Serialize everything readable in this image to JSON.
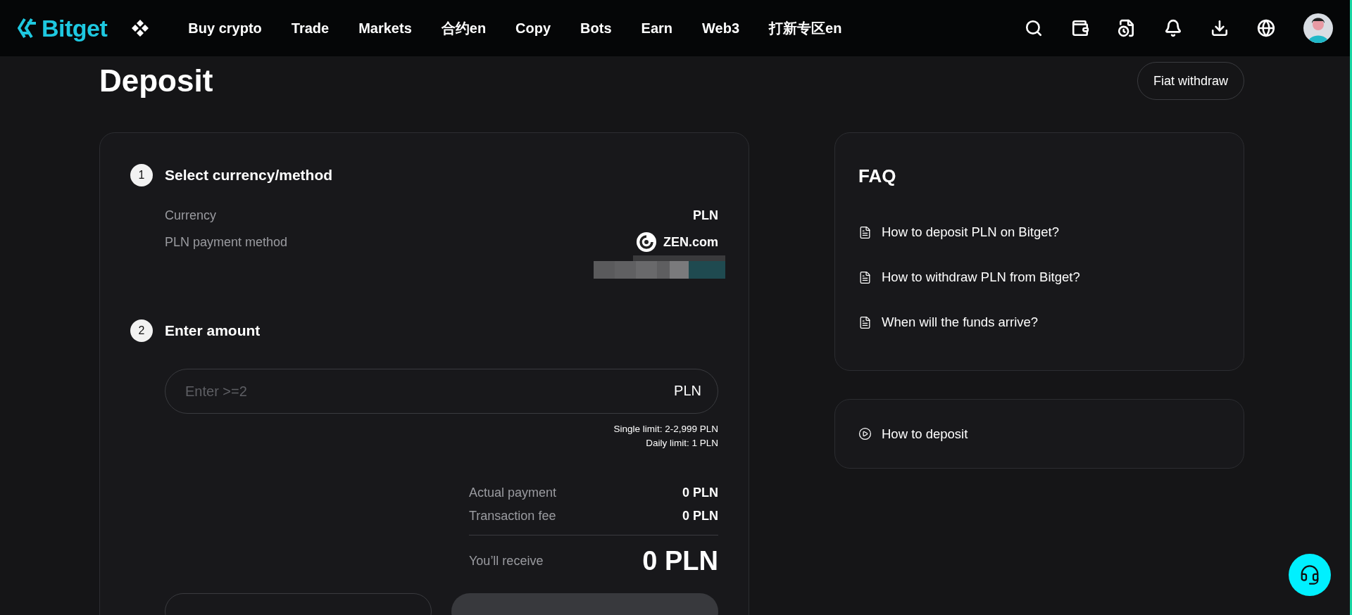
{
  "header": {
    "logo": "Bitget",
    "nav": [
      "Buy crypto",
      "Trade",
      "Markets",
      "合约en",
      "Copy",
      "Bots",
      "Earn",
      "Web3",
      "打新专区en"
    ]
  },
  "title": "Deposit",
  "fiat_withdraw": "Fiat withdraw",
  "step_1": {
    "number": "1",
    "title": "Select currency/method",
    "fields": [
      {
        "label": "Currency",
        "value": "PLN"
      },
      {
        "label": "PLN payment method",
        "value": "ZEN.com"
      }
    ]
  },
  "step_2": {
    "number": "2",
    "title": "Enter amount",
    "amount_field": {
      "placeholder": "Enter >=2",
      "unit": "PLN"
    },
    "limits": [
      "Single limit: 2-2,999 PLN",
      "Daily limit: 1 PLN"
    ],
    "summary": [
      {
        "label": "Actual payment",
        "value": "0 PLN"
      },
      {
        "label": "Transaction fee",
        "value": "0 PLN"
      }
    ],
    "receive": {
      "label": "You’ll receive",
      "value": "0 PLN"
    }
  },
  "faq": {
    "title": "FAQ",
    "items": [
      "How to deposit PLN on Bitget?",
      "How to withdraw PLN from Bitget?",
      "When will the funds arrive?"
    ]
  },
  "video_link": "How to deposit"
}
